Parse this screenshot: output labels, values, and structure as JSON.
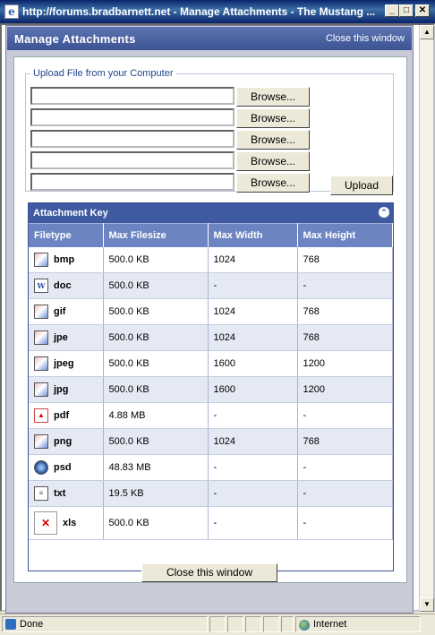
{
  "window": {
    "title": "http://forums.bradbarnett.net - Manage Attachments - The Mustang ...",
    "minimize": "_",
    "maximize": "□",
    "close": "✕"
  },
  "dialog": {
    "title": "Manage Attachments",
    "close_link": "Close this window"
  },
  "upload": {
    "legend": "Upload File from your Computer",
    "browse_label": "Browse...",
    "upload_label": "Upload",
    "file_fields": [
      "",
      "",
      "",
      "",
      ""
    ]
  },
  "attachment_key": {
    "title": "Attachment Key",
    "columns": [
      "Filetype",
      "Max Filesize",
      "Max Width",
      "Max Height"
    ],
    "rows": [
      {
        "icon": "image-icon",
        "type": "bmp",
        "size": "500.0 KB",
        "width": "1024",
        "height": "768"
      },
      {
        "icon": "word-doc-icon",
        "type": "doc",
        "size": "500.0 KB",
        "width": "-",
        "height": "-"
      },
      {
        "icon": "image-icon",
        "type": "gif",
        "size": "500.0 KB",
        "width": "1024",
        "height": "768"
      },
      {
        "icon": "image-icon",
        "type": "jpe",
        "size": "500.0 KB",
        "width": "1024",
        "height": "768"
      },
      {
        "icon": "image-icon",
        "type": "jpeg",
        "size": "500.0 KB",
        "width": "1600",
        "height": "1200"
      },
      {
        "icon": "image-icon",
        "type": "jpg",
        "size": "500.0 KB",
        "width": "1600",
        "height": "1200"
      },
      {
        "icon": "pdf-icon",
        "type": "pdf",
        "size": "4.88 MB",
        "width": "-",
        "height": "-"
      },
      {
        "icon": "image-icon",
        "type": "png",
        "size": "500.0 KB",
        "width": "1024",
        "height": "768"
      },
      {
        "icon": "psd-icon",
        "type": "psd",
        "size": "48.83 MB",
        "width": "-",
        "height": "-"
      },
      {
        "icon": "text-file-icon",
        "type": "txt",
        "size": "19.5 KB",
        "width": "-",
        "height": "-"
      },
      {
        "icon": "broken-image-icon",
        "type": "xls",
        "size": "500.0 KB",
        "width": "-",
        "height": "-"
      }
    ]
  },
  "footer": {
    "close_button": "Close this window"
  },
  "statusbar": {
    "status": "Done",
    "zone": "Internet"
  }
}
